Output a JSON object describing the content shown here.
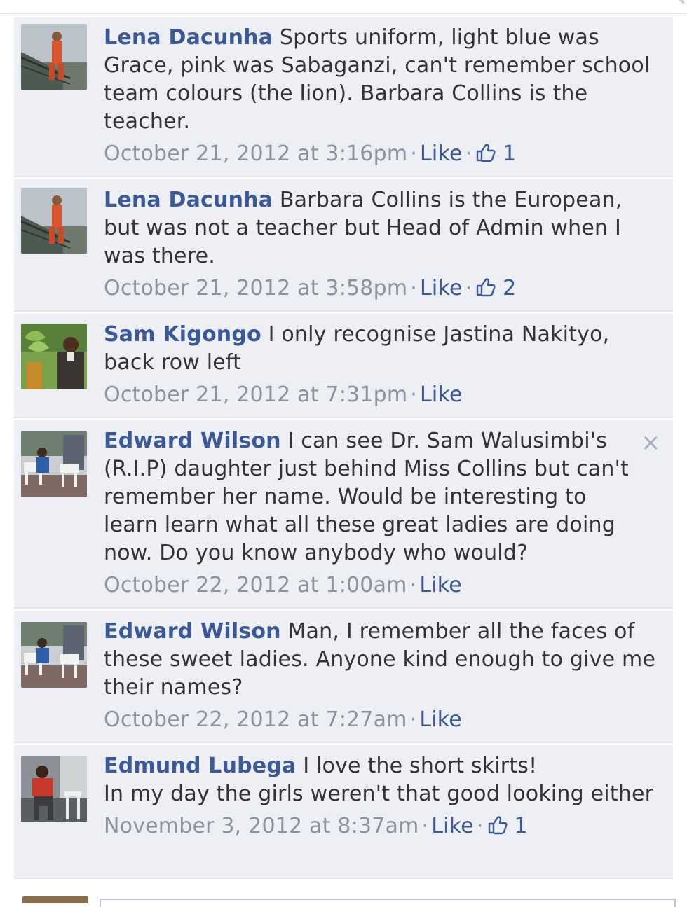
{
  "corner_icon": "pencil-icon",
  "comments": [
    {
      "author": "Lena Dacunha",
      "text": "Sports uniform, light blue was Grace, pink was Sabaganzi, can't remember school team colours (the lion). Barbara Collins is the teacher.",
      "timestamp": "October 21, 2012 at 3:16pm",
      "like_label": "Like",
      "like_count": "1",
      "has_likes": true,
      "avatar_icon": "profile-photo-person-on-railing"
    },
    {
      "author": "Lena Dacunha",
      "text": "Barbara Collins is the European, but was not a teacher but Head of Admin when I was there.",
      "timestamp": "October 21, 2012 at 3:58pm",
      "like_label": "Like",
      "like_count": "2",
      "has_likes": true,
      "avatar_icon": "profile-photo-person-on-railing"
    },
    {
      "author": "Sam Kigongo",
      "text": "I only recognise Jastina Nakityo, back row left",
      "timestamp": "October 21, 2012 at 7:31pm",
      "like_label": "Like",
      "like_count": "",
      "has_likes": false,
      "avatar_icon": "profile-photo-man-garden"
    },
    {
      "author": "Edward Wilson",
      "text": "I can see Dr. Sam Walusimbi's (R.I.P) daughter just behind Miss Collins but can't remember her name. Would be interesting to learn learn what all these great ladies are doing now. Do you know anybody who would?",
      "timestamp": "October 22, 2012 at 1:00am",
      "like_label": "Like",
      "like_count": "",
      "has_likes": false,
      "show_close": true,
      "close_icon": "close-icon",
      "avatar_icon": "profile-photo-outdoor-chairs"
    },
    {
      "author": "Edward Wilson",
      "text": "Man, I remember all the faces of these sweet ladies. Anyone kind enough to give me their names?",
      "timestamp": "October 22, 2012 at 7:27am",
      "like_label": "Like",
      "like_count": "",
      "has_likes": false,
      "avatar_icon": "profile-photo-outdoor-chairs"
    },
    {
      "author": "Edmund Lubega",
      "text": "I love the short skirts!\nIn my day the girls weren't that good looking either",
      "timestamp": "November 3, 2012 at 8:37am",
      "like_label": "Like",
      "like_count": "1",
      "has_likes": true,
      "avatar_icon": "profile-photo-man-seated"
    }
  ],
  "colors": {
    "author": "#3b5998",
    "comment_bg": "#edeff4",
    "meta": "#8d939c",
    "text": "#333333"
  }
}
